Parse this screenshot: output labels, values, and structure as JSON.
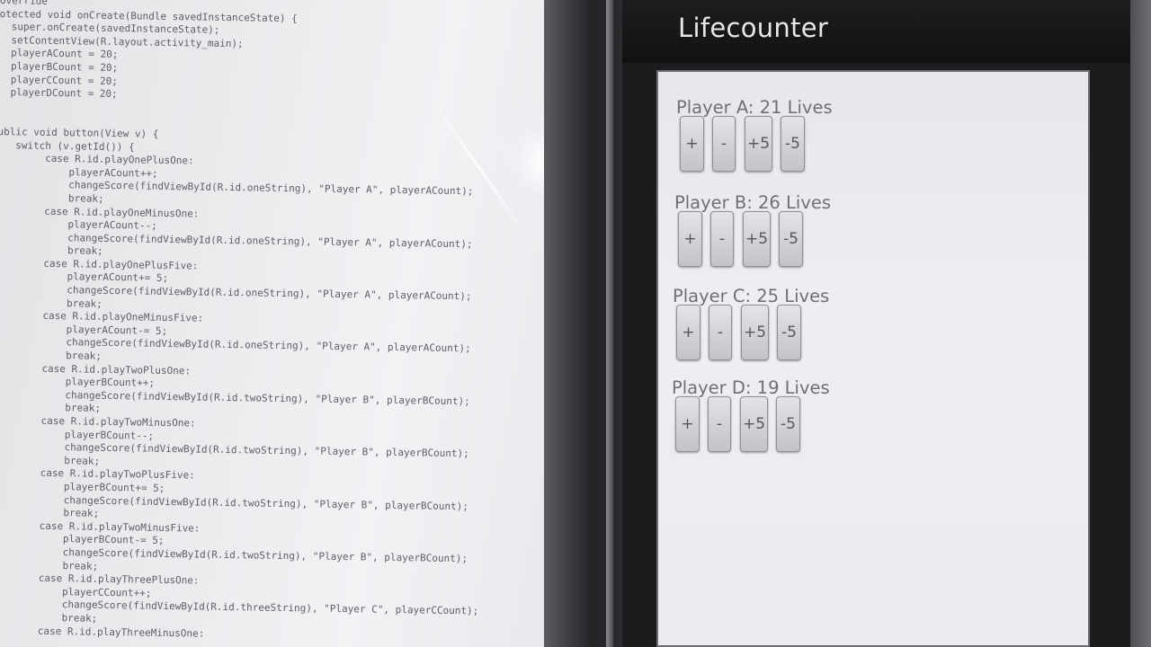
{
  "code_editor": {
    "lines": [
      "Override",
      "otected void onCreate(Bundle savedInstanceState) {",
      "  super.onCreate(savedInstanceState);",
      "  setContentView(R.layout.activity_main);",
      "  playerACount = 20;",
      "  playerBCount = 20;",
      "  playerCCount = 20;",
      "  playerDCount = 20;",
      "",
      "",
      "ublic void button(View v) {",
      "   switch (v.getId()) {",
      "        case R.id.playOnePlusOne:",
      "            playerACount++;",
      "            changeScore(findViewById(R.id.oneString), \"Player A\", playerACount);",
      "            break;",
      "        case R.id.playOneMinusOne:",
      "            playerACount--;",
      "            changeScore(findViewById(R.id.oneString), \"Player A\", playerACount);",
      "            break;",
      "        case R.id.playOnePlusFive:",
      "            playerACount+= 5;",
      "            changeScore(findViewById(R.id.oneString), \"Player A\", playerACount);",
      "            break;",
      "        case R.id.playOneMinusFive:",
      "            playerACount-= 5;",
      "            changeScore(findViewById(R.id.oneString), \"Player A\", playerACount);",
      "            break;",
      "        case R.id.playTwoPlusOne:",
      "            playerBCount++;",
      "            changeScore(findViewById(R.id.twoString), \"Player B\", playerBCount);",
      "            break;",
      "        case R.id.playTwoMinusOne:",
      "            playerBCount--;",
      "            changeScore(findViewById(R.id.twoString), \"Player B\", playerBCount);",
      "            break;",
      "        case R.id.playTwoPlusFive:",
      "            playerBCount+= 5;",
      "            changeScore(findViewById(R.id.twoString), \"Player B\", playerBCount);",
      "            break;",
      "        case R.id.playTwoMinusFive:",
      "            playerBCount-= 5;",
      "            changeScore(findViewById(R.id.twoString), \"Player B\", playerBCount);",
      "            break;",
      "        case R.id.playThreePlusOne:",
      "            playerCCount++;",
      "            changeScore(findViewById(R.id.threeString), \"Player C\", playerCCount);",
      "            break;",
      "        case R.id.playThreeMinusOne:"
    ]
  },
  "app": {
    "title": "Lifecounter"
  },
  "players": [
    {
      "label": "Player A: 21 Lives",
      "buttons": [
        "+",
        "-",
        "+5",
        "-5"
      ]
    },
    {
      "label": "Player B: 26 Lives",
      "buttons": [
        "+",
        "-",
        "+5",
        "-5"
      ]
    },
    {
      "label": "Player C: 25 Lives",
      "buttons": [
        "+",
        "-",
        "+5",
        "-5"
      ]
    },
    {
      "label": "Player D: 19 Lives",
      "buttons": [
        "+",
        "-",
        "+5",
        "-5"
      ]
    }
  ]
}
